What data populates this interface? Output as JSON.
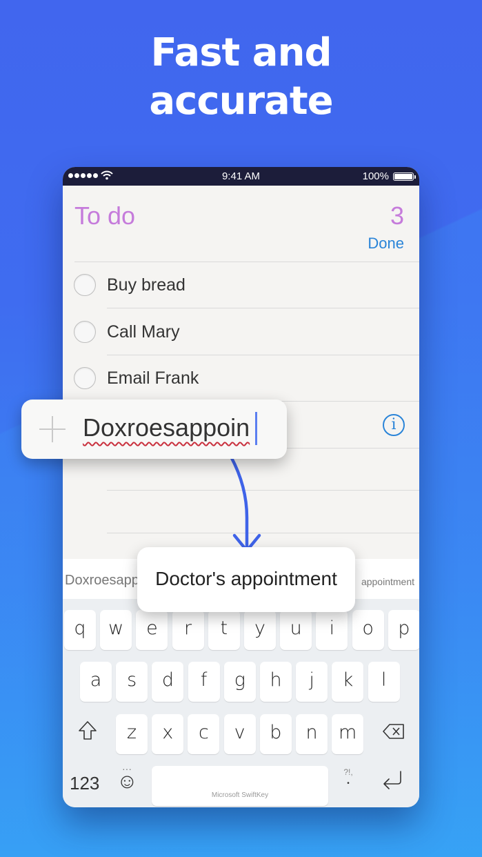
{
  "headline": {
    "line1": "Fast and",
    "line2": "accurate"
  },
  "status_bar": {
    "signal_dots": 5,
    "time": "9:41 AM",
    "battery_percent": "100%",
    "battery_level": 1.0
  },
  "list": {
    "title": "To do",
    "count": "3",
    "done_label": "Done",
    "items": [
      {
        "label": "Buy bread",
        "checked": false
      },
      {
        "label": "Call Mary",
        "checked": false
      },
      {
        "label": "Email Frank",
        "checked": false
      }
    ],
    "info_icon": "i"
  },
  "new_item": {
    "add_icon": "plus-icon",
    "typed_text": "Doxroesappoin",
    "misspelled": true
  },
  "prediction_popup": {
    "text": "Doctor's appointment"
  },
  "suggestion_bar": {
    "left": "Doxroesapp",
    "right": "appointment"
  },
  "keyboard": {
    "row1": [
      "q",
      "w",
      "e",
      "r",
      "t",
      "y",
      "u",
      "i",
      "o",
      "p"
    ],
    "row2": [
      "a",
      "s",
      "d",
      "f",
      "g",
      "h",
      "j",
      "k",
      "l"
    ],
    "row3": [
      "z",
      "x",
      "c",
      "v",
      "b",
      "n",
      "m"
    ],
    "numbers_label": "123",
    "emoji_icon": "☺",
    "emoji_dots": "···",
    "space_label": "Microsoft SwiftKey",
    "punct_label": "?!,",
    "punct_dot": "•",
    "shift_icon": "shift-icon",
    "delete_icon": "backspace-icon",
    "return_icon": "return-icon"
  },
  "colors": {
    "background": "#4166ee",
    "title_purple": "#c57bdb",
    "link_blue": "#2a84d8",
    "arrow_blue": "#3f63e8",
    "misspell_red": "#c9303d"
  }
}
